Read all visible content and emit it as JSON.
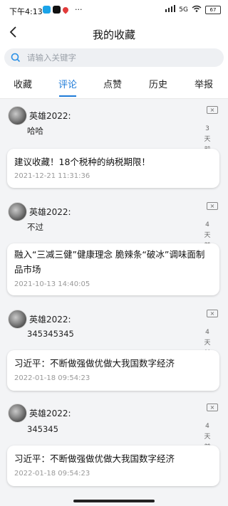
{
  "status_bar": {
    "time": "下午4:13",
    "dots": "···",
    "network": "5G",
    "battery": "67"
  },
  "header": {
    "back": "<",
    "title": "我的收藏"
  },
  "search": {
    "placeholder": "请输入关键字"
  },
  "tabs": [
    {
      "label": "收藏",
      "active": false
    },
    {
      "label": "评论",
      "active": true
    },
    {
      "label": "点赞",
      "active": false
    },
    {
      "label": "历史",
      "active": false
    },
    {
      "label": "举报",
      "active": false
    }
  ],
  "items": [
    {
      "user": "英雄2022:",
      "comment": "哈哈",
      "time_ago": [
        "3天",
        "前"
      ],
      "card_title": "建议收藏！18个税种的纳税期限！",
      "card_date": "2021-12-21 11:31:36"
    },
    {
      "user": "英雄2022:",
      "comment": "不过",
      "time_ago": [
        "4天",
        "前"
      ],
      "card_title": "融入“三减三健”健康理念 脆辣条“破冰”调味面制品市场",
      "card_date": "2021-10-13 14:40:05"
    },
    {
      "user": "英雄2022:",
      "comment": "345345345",
      "time_ago": [
        "4天",
        "前"
      ],
      "card_title": "习近平：不断做强做优做大我国数字经济",
      "card_date": "2022-01-18 09:54:23"
    },
    {
      "user": "英雄2022:",
      "comment": "345345",
      "time_ago": [
        "4天",
        "前"
      ],
      "card_title": "习近平：不断做强做优做大我国数字经济",
      "card_date": "2022-01-18 09:54:23"
    }
  ],
  "close_symbol": "×",
  "colors": {
    "accent": "#1e7bd8",
    "background": "#f3f4f6"
  }
}
